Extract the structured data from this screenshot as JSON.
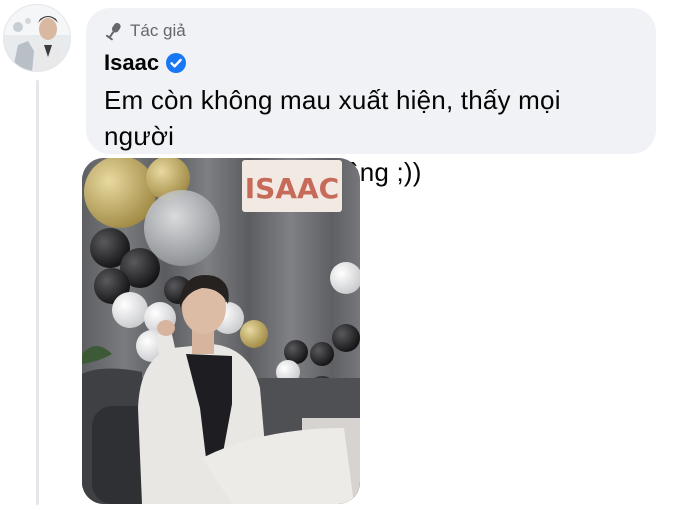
{
  "comment": {
    "role_icon": "microphone-icon",
    "role_label": "Tác giả",
    "author_name": "Isaac",
    "verified_icon": "verified-badge-icon",
    "text": "Em còn không mau xuất hiện, thấy mọi người\nhối quá chừng rồi không ;))"
  },
  "colors": {
    "bubble_bg": "#f0f2f5",
    "role_text": "#65676b",
    "name_text": "#050505",
    "verified_blue": "#1877f2",
    "thread_line": "#e4e6eb"
  },
  "photo": {
    "backdrop_sign_text": "ISAAC"
  }
}
